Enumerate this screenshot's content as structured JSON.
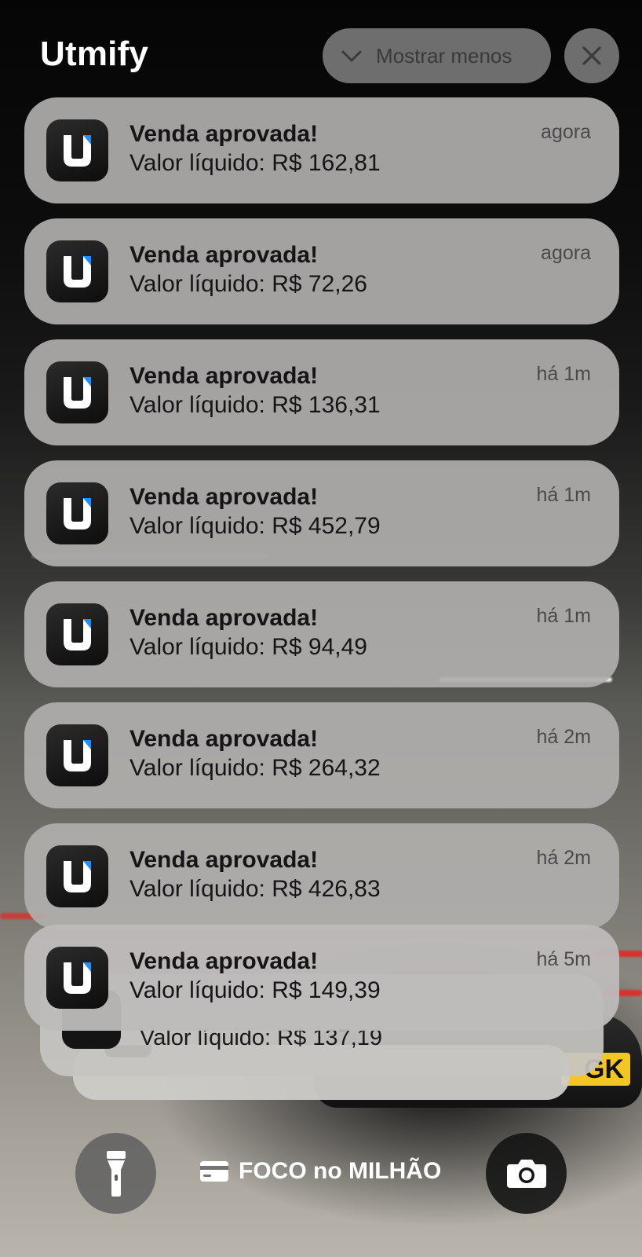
{
  "header": {
    "app_name": "Utmify",
    "show_less_label": "Mostrar menos"
  },
  "notifications": [
    {
      "title": "Venda aprovada!",
      "body": "Valor líquido: R$ 162,81",
      "time": "agora"
    },
    {
      "title": "Venda aprovada!",
      "body": "Valor líquido: R$ 72,26",
      "time": "agora"
    },
    {
      "title": "Venda aprovada!",
      "body": "Valor líquido: R$ 136,31",
      "time": "há 1m"
    },
    {
      "title": "Venda aprovada!",
      "body": "Valor líquido: R$ 452,79",
      "time": "há 1m"
    },
    {
      "title": "Venda aprovada!",
      "body": "Valor líquido: R$ 94,49",
      "time": "há 1m"
    },
    {
      "title": "Venda aprovada!",
      "body": "Valor líquido: R$ 264,32",
      "time": "há 2m"
    },
    {
      "title": "Venda aprovada!",
      "body": "Valor líquido: R$ 426,83",
      "time": "há 2m"
    },
    {
      "title": "Venda aprovada!",
      "body": "Valor líquido: R$ 149,39",
      "time": "há 5m"
    }
  ],
  "stacked_notification": {
    "body": "Valor líquido: R$ 137,19"
  },
  "focus": {
    "label": "FOCO no MILHÃO",
    "icon": "card-icon"
  },
  "controls": {
    "left_icon": "flashlight-icon",
    "right_icon": "camera-icon"
  },
  "colors": {
    "notification_bg": "#b0afac",
    "app_icon_accent": "#1e8fff"
  }
}
